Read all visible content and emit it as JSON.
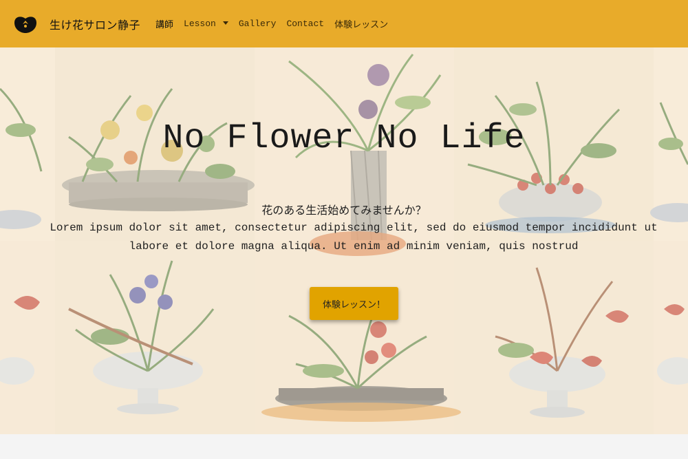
{
  "navbar": {
    "brand_text": "生け花サロン静子",
    "brand_icon": "persimmon-logo-icon",
    "links": [
      {
        "label": "講師"
      },
      {
        "label": "Lesson",
        "has_dropdown": true
      },
      {
        "label": "Gallery"
      },
      {
        "label": "Contact"
      },
      {
        "label": "体験レッスン"
      }
    ]
  },
  "hero": {
    "title": "No Flower No Life",
    "subtitle": "花のある生活始めてみませんか？",
    "body": "Lorem ipsum dolor sit amet, consectetur adipiscing elit, sed do eiusmod tempor incididunt ut labore et dolore magna aliqua. Ut enim ad minim veniam, quis nostrud",
    "cta_label": "体験レッスン！"
  },
  "colors": {
    "navbar_bg": "#e8ab2a",
    "cta_bg": "#e1a300",
    "hero_overlay": "#faf0e0"
  }
}
